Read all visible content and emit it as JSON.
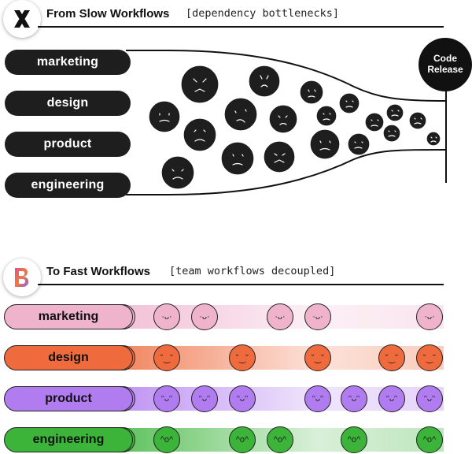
{
  "top": {
    "title": "From Slow Workflows",
    "subtitle": "[dependency bottlenecks]",
    "logo_icon": "x-logo-icon",
    "teams": [
      "marketing",
      "design",
      "product",
      "engineering"
    ],
    "release": {
      "line1": "Code",
      "line2": "Release"
    }
  },
  "bottom": {
    "title": "To Fast Workflows",
    "subtitle": "[team workflows decoupled]",
    "logo_icon": "brand-b-logo-icon",
    "lanes": [
      {
        "label": "marketing",
        "color": "#efb3cc",
        "face": "ᵕ̈",
        "glyph": "·ᴗ·",
        "positions": [
          212,
          260,
          356,
          404,
          546
        ]
      },
      {
        "label": "design",
        "color": "#ef6a3c",
        "glyph": "˘‿˘",
        "positions": [
          212,
          308,
          404,
          498,
          546
        ]
      },
      {
        "label": "product",
        "color": "#b17cf0",
        "glyph": "ᵔᴗᵔ",
        "positions": [
          212,
          260,
          308,
          404,
          450,
          498,
          546
        ]
      },
      {
        "label": "engineering",
        "color": "#3cb43a",
        "glyph": "^o^",
        "positions": [
          212,
          308,
          356,
          450,
          546
        ]
      }
    ]
  }
}
